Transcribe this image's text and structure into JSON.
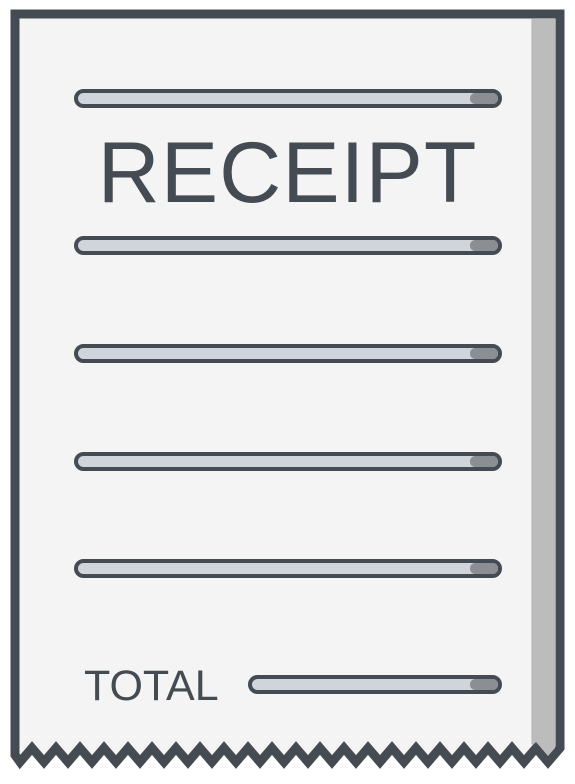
{
  "receipt": {
    "title": "RECEIPT",
    "total_label": "TOTAL"
  },
  "colors": {
    "outline": "#454b52",
    "paper": "#f4f4f4",
    "shadow": "#bcbcbc",
    "line_fill": "#cfd5da",
    "line_end": "#8b8f93"
  }
}
